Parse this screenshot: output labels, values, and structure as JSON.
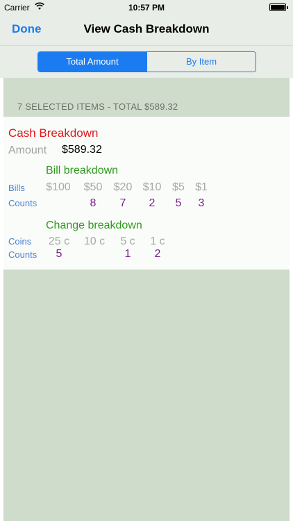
{
  "status_bar": {
    "carrier": "Carrier",
    "time": "10:57 PM",
    "icons": [
      "wifi-icon",
      "battery-icon"
    ]
  },
  "nav": {
    "done_label": "Done",
    "title": "View Cash Breakdown"
  },
  "segmented": {
    "tabs": [
      {
        "label": "Total Amount",
        "active": true
      },
      {
        "label": "By Item",
        "active": false
      }
    ]
  },
  "summary": "7  SELECTED ITEMS - TOTAL $589.32",
  "breakdown": {
    "title": "Cash Breakdown",
    "amount_label": "Amount",
    "amount_value": "$589.32",
    "bills": {
      "title": "Bill breakdown",
      "row_label": "Bills",
      "count_label": "Counts",
      "denominations": [
        "$100",
        "$50",
        "$20",
        "$10",
        "$5",
        "$1"
      ],
      "counts": [
        "",
        "8",
        "7",
        "2",
        "5",
        "3"
      ]
    },
    "coins": {
      "title": "Change breakdown",
      "row_label": "Coins",
      "count_label": "Counts",
      "denominations": [
        "25 c",
        "10 c",
        "5 c",
        "1 c"
      ],
      "counts": [
        "5",
        "",
        "1",
        "2"
      ]
    }
  },
  "colors": {
    "accent": "#1a7cf0",
    "title_red": "#e0181b",
    "green": "#2e9a1e",
    "purple": "#7b1e8e",
    "background": "#cfdbcb"
  }
}
